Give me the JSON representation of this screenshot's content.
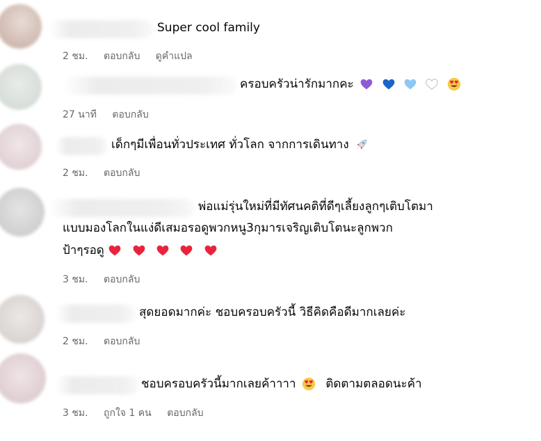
{
  "comments": [
    {
      "text_lines": [
        "Super cool family"
      ],
      "time": "2 ชม.",
      "reply": "ตอบกลับ",
      "translate": "ดูคำแปล"
    },
    {
      "text_lines": [
        "ครอบครัวน่ารักมากคะ"
      ],
      "emojis": [
        "purple-heart",
        "blue-heart",
        "light-blue-heart",
        "white-heart",
        "heart-eyes"
      ],
      "time": "27 นาที",
      "reply": "ตอบกลับ"
    },
    {
      "text_lines": [
        "เด็กๆมีเพื่อนทั่วประเทศ ทั่วโลก จากการเดินทาง"
      ],
      "emojis": [
        "rocket"
      ],
      "time": "2 ชม.",
      "reply": "ตอบกลับ"
    },
    {
      "text_lines": [
        "พ่อแม่รุ่นใหม่ที่มีทัศนคติที่ดีๆเลี้ยงลูกๆเติบโตมา",
        "แบบมองโลกในแง่ดีเสมอรอดูพวกหนู3กุมารเจริญเติบโตนะลูกพวก",
        "ป้าๆรอดู"
      ],
      "emojis": [
        "red-heart",
        "red-heart",
        "red-heart",
        "red-heart",
        "red-heart"
      ],
      "time": "3 ชม.",
      "reply": "ตอบกลับ"
    },
    {
      "text_lines": [
        "สุดยอดมากค่ะ ชอบครอบครัวนี้ วิธีคิดคือดีมากเลยค่ะ"
      ],
      "time": "2 ชม.",
      "reply": "ตอบกลับ"
    },
    {
      "text_before": "ชอบครอบครัวนี้มากเลยค้าาาา",
      "text_after": "ติดตามตลอดนะค้า",
      "emojis": [
        "heart-eyes"
      ],
      "time": "3 ชม.",
      "likes": "ถูกใจ 1 คน",
      "reply": "ตอบกลับ"
    }
  ],
  "colors": {
    "text": "#050505",
    "meta": "#65676b",
    "red_heart": "#e8243c",
    "purple_heart": "#8e5bd6",
    "blue_heart": "#1b63c9",
    "light_blue_heart": "#8cc8f2"
  }
}
